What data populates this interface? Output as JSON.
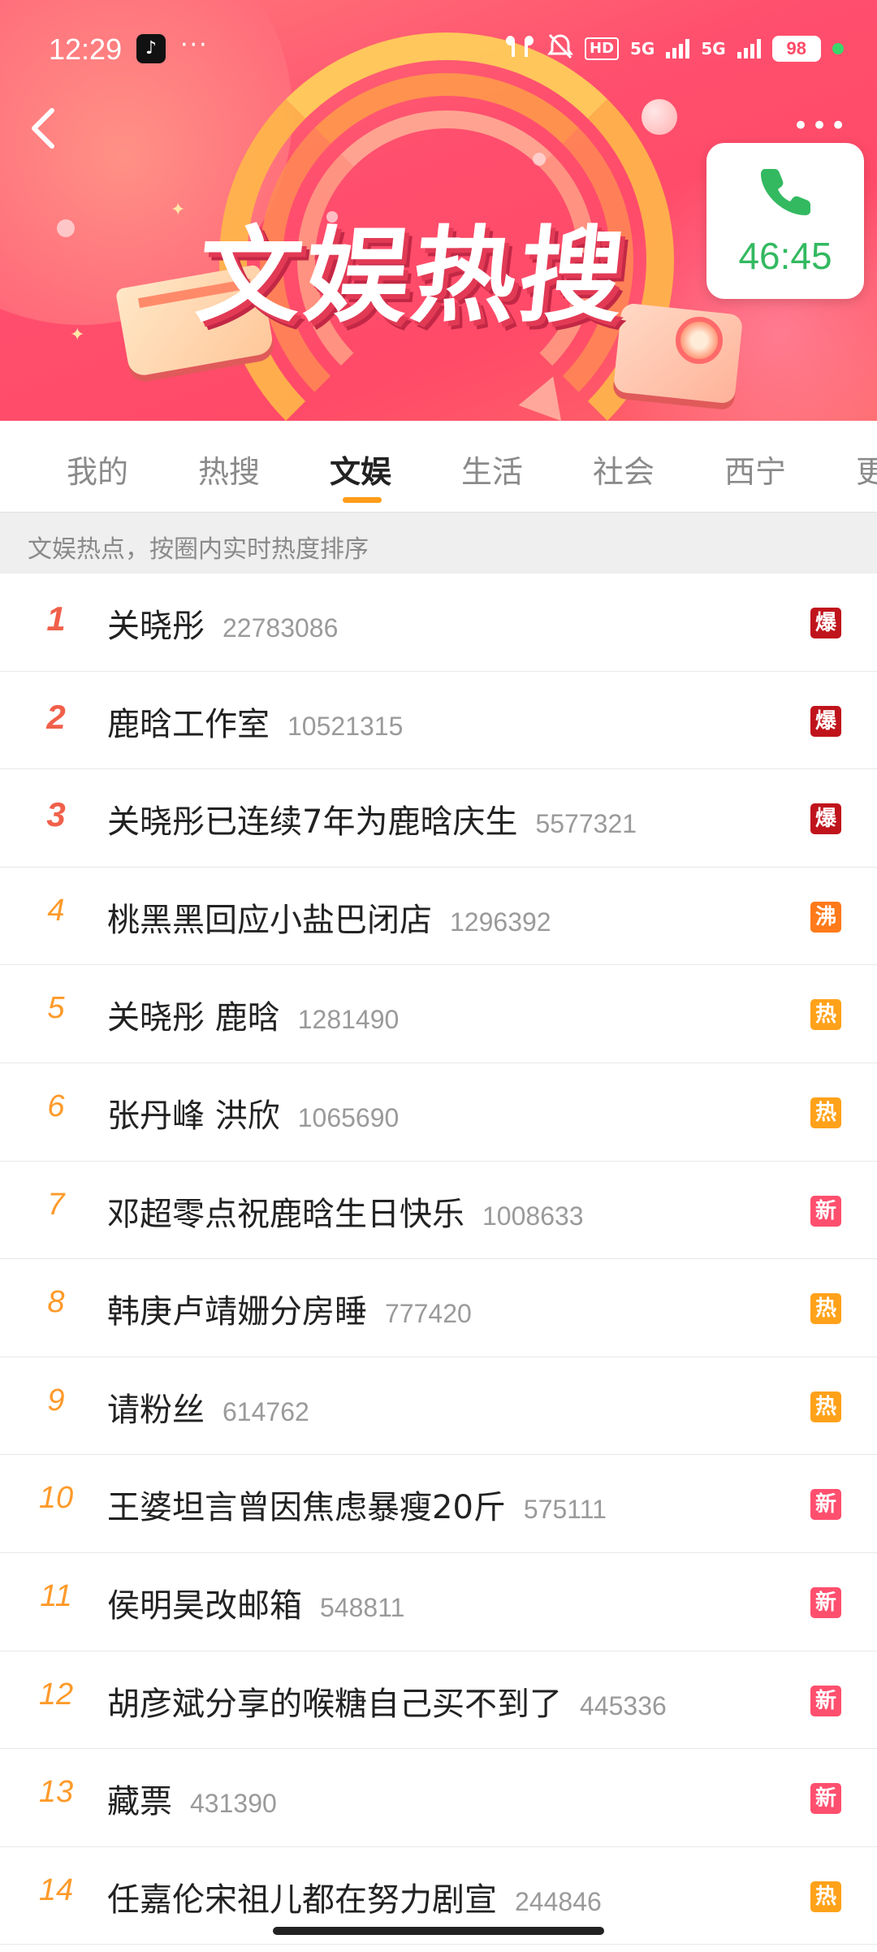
{
  "status_bar": {
    "time": "12:29",
    "notification_dots": "···",
    "network_1": "5G",
    "network_2": "5G",
    "hd_label": "HD",
    "battery": "98"
  },
  "banner": {
    "title": "文娱热搜",
    "menu_dots": "•••"
  },
  "call": {
    "duration": "46:45"
  },
  "tabs": [
    {
      "label": "我的"
    },
    {
      "label": "热搜"
    },
    {
      "label": "文娱",
      "active": true
    },
    {
      "label": "生活"
    },
    {
      "label": "社会"
    },
    {
      "label": "西宁"
    },
    {
      "label": "更"
    }
  ],
  "subheader": "文娱热点，按圈内实时热度排序",
  "badge_colors": {
    "爆": "#c0141c",
    "沸": "#ff7a1a",
    "热": "#ffa21a",
    "新": "#ff4f6e"
  },
  "items": [
    {
      "rank": "1",
      "title": "关晓彤",
      "count": "22783086",
      "badge": "爆"
    },
    {
      "rank": "2",
      "title": "鹿晗工作室",
      "count": "10521315",
      "badge": "爆"
    },
    {
      "rank": "3",
      "title": "关晓彤已连续7年为鹿晗庆生",
      "count": "5577321",
      "badge": "爆"
    },
    {
      "rank": "4",
      "title": "桃黑黑回应小盐巴闭店",
      "count": "1296392",
      "badge": "沸"
    },
    {
      "rank": "5",
      "title": "关晓彤 鹿晗",
      "count": "1281490",
      "badge": "热"
    },
    {
      "rank": "6",
      "title": "张丹峰 洪欣",
      "count": "1065690",
      "badge": "热"
    },
    {
      "rank": "7",
      "title": "邓超零点祝鹿晗生日快乐",
      "count": "1008633",
      "badge": "新"
    },
    {
      "rank": "8",
      "title": "韩庚卢靖姗分房睡",
      "count": "777420",
      "badge": "热"
    },
    {
      "rank": "9",
      "title": "请粉丝",
      "count": "614762",
      "badge": "热"
    },
    {
      "rank": "10",
      "title": "王婆坦言曾因焦虑暴瘦20斤",
      "count": "575111",
      "badge": "新"
    },
    {
      "rank": "11",
      "title": "侯明昊改邮箱",
      "count": "548811",
      "badge": "新"
    },
    {
      "rank": "12",
      "title": "胡彦斌分享的喉糖自己买不到了",
      "count": "445336",
      "badge": "新"
    },
    {
      "rank": "13",
      "title": "藏票",
      "count": "431390",
      "badge": "新"
    },
    {
      "rank": "14",
      "title": "任嘉伦宋祖儿都在努力剧宣",
      "count": "244846",
      "badge": "热"
    }
  ]
}
